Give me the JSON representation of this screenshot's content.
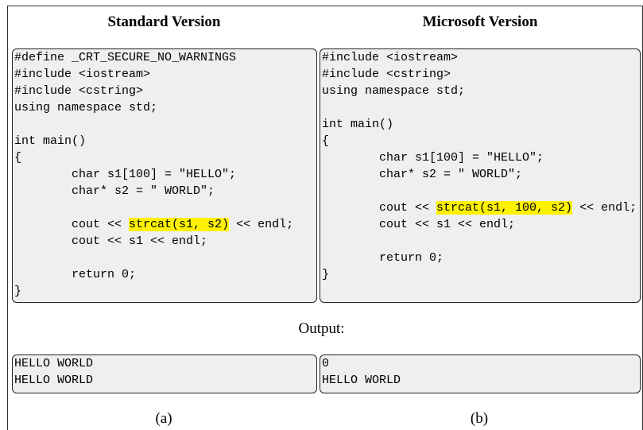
{
  "left": {
    "heading": "Standard Version",
    "code": [
      {
        "text": "#define _CRT_SECURE_NO_WARNINGS"
      },
      {
        "text": "#include <iostream>"
      },
      {
        "text": "#include <cstring>"
      },
      {
        "text": "using namespace std;"
      },
      {
        "text": ""
      },
      {
        "text": "int main()"
      },
      {
        "text": "{"
      },
      {
        "text": "        char s1[100] = \"HELLO\";"
      },
      {
        "text": "        char* s2 = \" WORLD\";"
      },
      {
        "text": ""
      },
      {
        "text": "        cout << ",
        "hl": "strcat(s1, s2)",
        "after": " << endl;"
      },
      {
        "text": "        cout << s1 << endl;"
      },
      {
        "text": ""
      },
      {
        "text": "        return 0;"
      },
      {
        "text": "}"
      }
    ],
    "output": [
      "HELLO WORLD",
      "HELLO WORLD"
    ],
    "caption": "(a)"
  },
  "right": {
    "heading": "Microsoft Version",
    "code": [
      {
        "text": "#include <iostream>"
      },
      {
        "text": "#include <cstring>"
      },
      {
        "text": "using namespace std;"
      },
      {
        "text": ""
      },
      {
        "text": "int main()"
      },
      {
        "text": "{"
      },
      {
        "text": "        char s1[100] = \"HELLO\";"
      },
      {
        "text": "        char* s2 = \" WORLD\";"
      },
      {
        "text": ""
      },
      {
        "text": "        cout << ",
        "hl": "strcat(s1, 100, s2)",
        "after": " << endl;"
      },
      {
        "text": "        cout << s1 << endl;"
      },
      {
        "text": ""
      },
      {
        "text": "        return 0;"
      },
      {
        "text": "}"
      }
    ],
    "output": [
      "0",
      "HELLO WORLD"
    ],
    "caption": "(b)"
  },
  "output_label": "Output:",
  "colors": {
    "highlight": "#fff200",
    "box_background": "#efefef"
  }
}
